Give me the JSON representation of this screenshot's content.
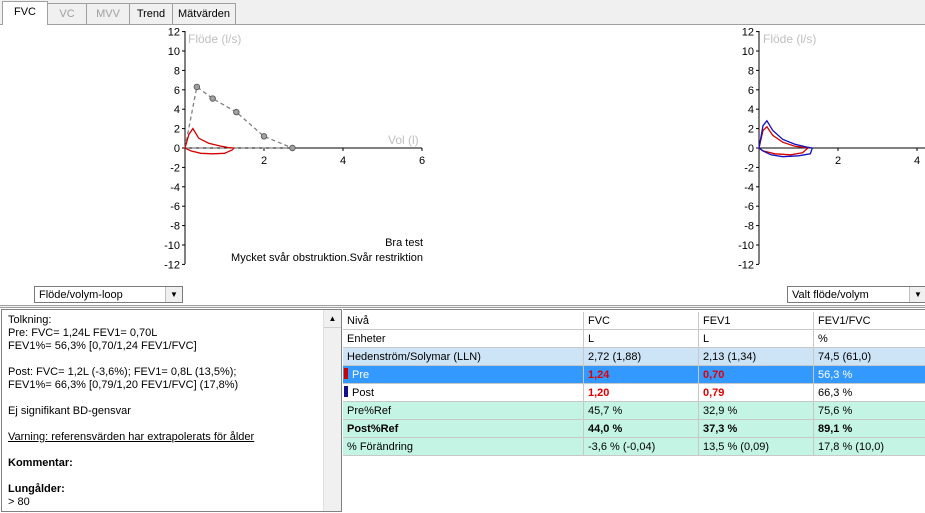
{
  "tabs": [
    {
      "label": "FVC",
      "state": "active"
    },
    {
      "label": "VC",
      "state": "disabled"
    },
    {
      "label": "MVV",
      "state": "disabled"
    },
    {
      "label": "Trend",
      "state": "normal"
    },
    {
      "label": "Mätvärden",
      "state": "normal"
    }
  ],
  "chart_data": [
    {
      "type": "line",
      "title": "",
      "ylabel": "Flöde (l/s)",
      "xlabel": "Vol (l)",
      "xlim": [
        0,
        6
      ],
      "ylim": [
        -12,
        12
      ],
      "x_ticks": [
        "2",
        "4",
        "6"
      ],
      "y_ticks": [
        "12",
        "10",
        "8",
        "6",
        "4",
        "2",
        "0",
        "-2",
        "-4",
        "-6",
        "-8",
        "-10",
        "-12"
      ],
      "grid": false,
      "series": [
        {
          "role": "reference-predicted",
          "color": "#808080",
          "style": "dashed",
          "x": [
            0.0,
            0.3,
            0.7,
            1.3,
            2.0,
            2.72,
            0.0
          ],
          "y": [
            0.0,
            6.3,
            5.1,
            3.7,
            1.2,
            0.0,
            0.0
          ],
          "markers_x": [
            0.3,
            0.7,
            1.3,
            2.0,
            2.72
          ],
          "markers_y": [
            6.3,
            5.1,
            3.7,
            1.2,
            0.0
          ]
        },
        {
          "role": "measured-pre",
          "color": "#d40000",
          "style": "solid",
          "x": [
            0.0,
            0.1,
            0.2,
            0.35,
            0.6,
            0.9,
            1.1,
            1.24,
            1.2,
            1.0,
            0.7,
            0.4,
            0.15,
            0.0
          ],
          "y": [
            0.0,
            1.4,
            2.0,
            1.0,
            0.5,
            0.2,
            0.05,
            0.0,
            -0.2,
            -0.55,
            -0.6,
            -0.55,
            -0.3,
            0.0
          ]
        }
      ],
      "annotations": [
        "Bra test",
        "Mycket svår obstruktion.Svår restriktion"
      ]
    },
    {
      "type": "line",
      "title": "",
      "ylabel": "Flöde (l/s)",
      "xlabel": "",
      "xlim": [
        0,
        4
      ],
      "ylim": [
        -12,
        12
      ],
      "x_ticks": [
        "2",
        "4"
      ],
      "y_ticks": [
        "12",
        "10",
        "8",
        "6",
        "4",
        "2",
        "0",
        "-2",
        "-4",
        "-6",
        "-8",
        "-10",
        "-12"
      ],
      "grid": false,
      "series": [
        {
          "role": "pre",
          "color": "#d40000",
          "style": "solid",
          "x": [
            0.0,
            0.1,
            0.2,
            0.35,
            0.6,
            0.9,
            1.24,
            1.1,
            0.8,
            0.4,
            0.1,
            0.0
          ],
          "y": [
            0.0,
            1.8,
            2.2,
            1.3,
            0.6,
            0.2,
            0.0,
            -0.5,
            -0.7,
            -0.6,
            -0.3,
            0.0
          ]
        },
        {
          "role": "post",
          "color": "#1010c0",
          "style": "solid",
          "x": [
            0.0,
            0.1,
            0.2,
            0.35,
            0.6,
            0.9,
            1.2,
            1.35,
            1.3,
            1.0,
            0.6,
            0.3,
            0.1,
            0.0
          ],
          "y": [
            0.0,
            2.3,
            2.8,
            1.8,
            0.9,
            0.4,
            0.1,
            0.0,
            -0.6,
            -0.8,
            -0.9,
            -0.7,
            -0.3,
            0.0
          ]
        }
      ]
    }
  ],
  "left_select": {
    "value": "Flöde/volym-loop"
  },
  "right_select": {
    "value": "Valt flöde/volym"
  },
  "interpretation": {
    "lines": [
      "Tolkning:",
      "Pre: FVC= 1,24L FEV1= 0,70L",
      "FEV1%= 56,3% [0,70/1,24 FEV1/FVC]",
      "",
      "Post: FVC= 1,2L (-3,6%); FEV1= 0,8L (13,5%);",
      "FEV1%= 66,3% [0,79/1,20 FEV1/FVC] (17,8%)",
      "",
      "Ej signifikant BD-gensvar",
      "",
      "Varning: referensvärden har extrapolerats för ålder"
    ],
    "comment_label": "Kommentar:",
    "lung_age_label": "Lungålder:",
    "lung_age_value": "> 80"
  },
  "table": {
    "header": [
      "Nivå",
      "FVC",
      "FEV1",
      "FEV1/FVC"
    ],
    "rows": [
      {
        "style": "hdr",
        "cells": [
          "Enheter",
          "L",
          "L",
          "%"
        ]
      },
      {
        "style": "lln",
        "cells": [
          "Hedenström/Solymar (LLN)",
          "2,72 (1,88)",
          "2,13 (1,34)",
          "74,5 (61,0)"
        ]
      },
      {
        "style": "pre",
        "marker": "#cc0000",
        "cells": [
          "Pre",
          "1,24",
          "0,70",
          "56,3 %"
        ]
      },
      {
        "style": "post",
        "marker": "#10108c",
        "cells": [
          "Post",
          "1,20",
          "0,79",
          "66,3 %"
        ]
      },
      {
        "style": "green",
        "cells": [
          "Pre%Ref",
          "45,7 %",
          "32,9 %",
          "75,6 %"
        ]
      },
      {
        "style": "green bold",
        "cells": [
          "Post%Ref",
          "44,0 %",
          "37,3 %",
          "89,1 %"
        ]
      },
      {
        "style": "green",
        "cells": [
          "% Förändring",
          "-3,6 % (-0,04)",
          "13,5 % (0,09)",
          "17,8 % (10,0)"
        ]
      }
    ]
  }
}
